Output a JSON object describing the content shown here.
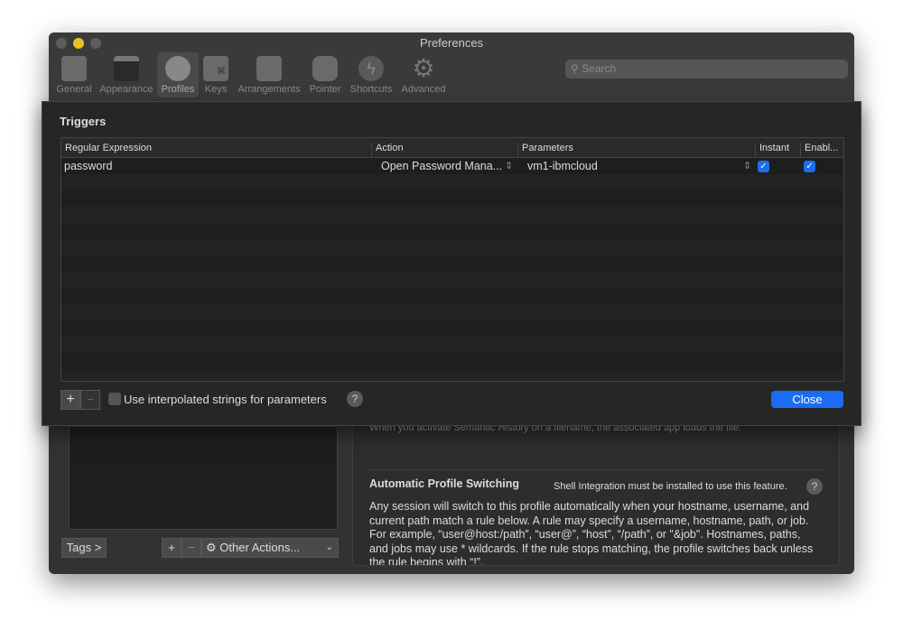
{
  "window": {
    "title": "Preferences"
  },
  "toolbar": {
    "items": [
      {
        "label": "General"
      },
      {
        "label": "Appearance"
      },
      {
        "label": "Profiles"
      },
      {
        "label": "Keys"
      },
      {
        "label": "Arrangements"
      },
      {
        "label": "Pointer"
      },
      {
        "label": "Shortcuts"
      },
      {
        "label": "Advanced"
      }
    ],
    "selected": "Profiles",
    "search_placeholder": "Search"
  },
  "sheet": {
    "title": "Triggers",
    "columns": [
      "Regular Expression",
      "Action",
      "Parameters",
      "Instant",
      "Enabl..."
    ],
    "rows": [
      {
        "regex": "password",
        "action": "Open Password Mana...",
        "parameters": "vm1-ibmcloud",
        "instant": true,
        "enabled": true
      }
    ],
    "add": "+",
    "remove": "−",
    "interpolated_label": "Use interpolated strings for parameters",
    "interpolated_checked": false,
    "help": "?",
    "close": "Close"
  },
  "left": {
    "tags": "Tags >",
    "add": "+",
    "remove": "−",
    "other_actions": "Other Actions..."
  },
  "right": {
    "semantic_history_text": "When you activate Semantic History on a filename, the associated app loads the file.",
    "aps_title": "Automatic Profile Switching",
    "aps_note": "Shell Integration must be installed to use this feature.",
    "help": "?",
    "aps_body": "Any session will switch to this profile automatically when your hostname, username, and current path match a rule below. A rule may specify a username, hostname, path, or job. For example, “user@host:/path”, “user@”, “host”, “/path”, or \"&job\". Hostnames, paths, and jobs may use * wildcards. If the rule stops matching, the profile switches back unless the rule begins with “!”."
  },
  "colors": {
    "accent": "#1a6cf0",
    "sheet_bg": "#262626",
    "window_bg": "#323232"
  }
}
